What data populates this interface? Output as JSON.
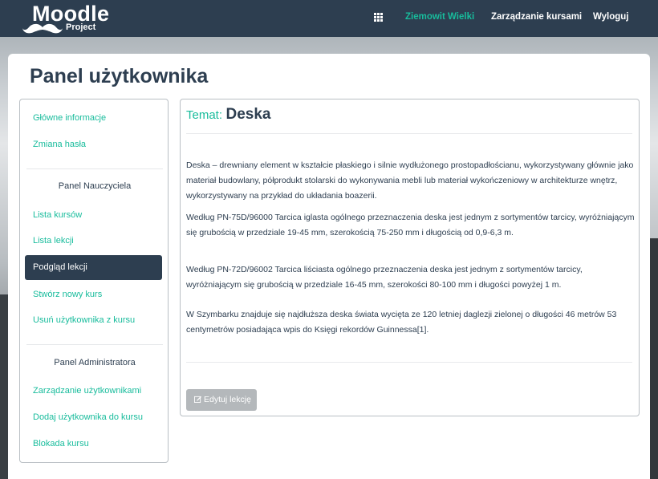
{
  "navbar": {
    "brand_title": "Moodle",
    "brand_sub": "Project",
    "user_name": "Ziemowit Wielki",
    "manage_courses": "Zarządzanie kursami",
    "logout": "Wyloguj"
  },
  "page": {
    "title": "Panel użytkownika"
  },
  "sidebar": {
    "general_info": "Główne informacje",
    "change_password": "Zmiana hasła",
    "teacher_panel_heading": "Panel Nauczyciela",
    "course_list": "Lista kursów",
    "lesson_list": "Lista lekcji",
    "lesson_preview": "Podgląd lekcji",
    "create_course": "Stwórz nowy kurs",
    "remove_user_from_course": "Usuń użytkownika z kursu",
    "admin_panel_heading": "Panel Administratora",
    "manage_users": "Zarządzanie użytkownikami",
    "add_user_to_course": "Dodaj użytkownika do kursu",
    "block_course": "Blokada kursu"
  },
  "lesson": {
    "topic_label": "Temat:",
    "topic_title": "Deska",
    "paragraphs": [
      "Deska – drewniany element w kształcie płaskiego i silnie wydłużonego prostopadłościanu, wykorzystywany głównie jako materiał budowlany, półprodukt stolarski do wykonywania mebli lub materiał wykończeniowy w architekturze wnętrz, wykorzystywany na przykład do układania boazerii.",
      "Według PN-75D/96000 Tarcica iglasta ogólnego przeznaczenia deska jest jednym z sortymentów tarcicy, wyróżniającym się grubością w przedziale 19-45 mm, szerokością 75-250 mm i długością od 0,9-6,3 m.",
      "Według PN-72D/96002 Tarcica liściasta ogólnego przeznaczenia deska jest jednym z sortymentów tarcicy, wyróżniającym się grubością w przedziale 16-45 mm, szerokości 80-100 mm i długości powyżej 1 m.",
      "W Szymbarku znajduje się najdłuższa deska świata wycięta ze 120 letniej daglezji zielonej o długości 46 metrów 53 centymetrów posiadająca wpis do Księgi rekordów Guinnessa[1]."
    ],
    "edit_button": "Edytuj lekcję"
  },
  "colors": {
    "navbar": "#2d3e50",
    "accent": "#18bc9c",
    "active_item": "#2d3e50",
    "disabled_button": "#b4b8bb"
  },
  "icons": [
    "mustache-logo-icon",
    "grid-icon",
    "edit-icon"
  ]
}
